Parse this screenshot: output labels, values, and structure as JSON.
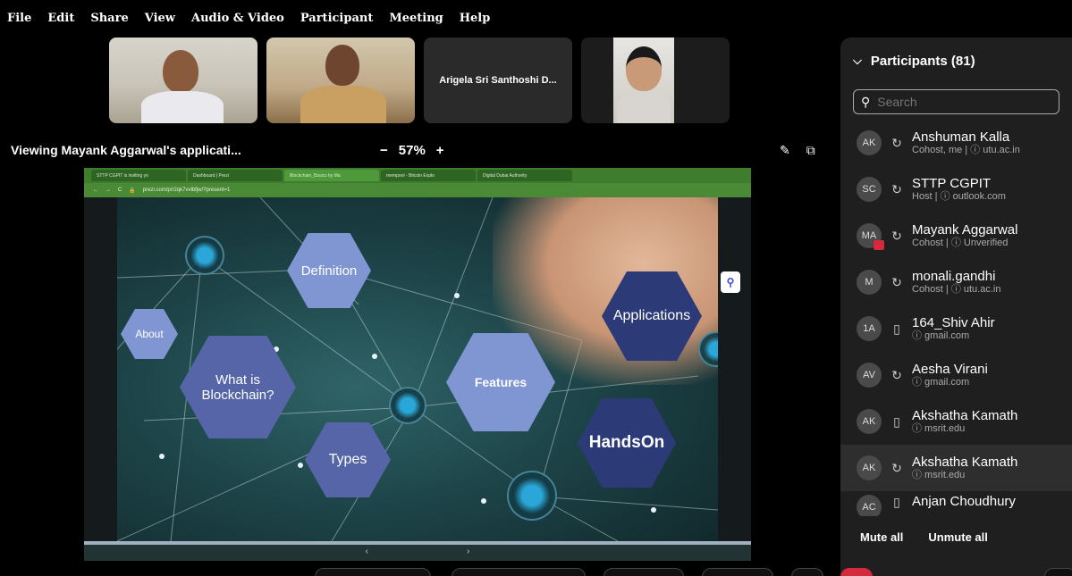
{
  "menu": [
    "File",
    "Edit",
    "Share",
    "View",
    "Audio & Video",
    "Participant",
    "Meeting",
    "Help"
  ],
  "tiles": {
    "third_name": "Arigela Sri Santhoshi D..."
  },
  "viewing": {
    "label": "Viewing Mayank Aggarwal's applicati...",
    "zoom_minus": "−",
    "zoom_level": "57%",
    "zoom_plus": "+"
  },
  "browser": {
    "tabs": [
      "STTP CGPIT is inviting yo",
      "Dashboard | Prezi",
      "Blockchain_Basics by Ma",
      "mempool - Bitcoin Explo",
      "Digital Dubai Authority"
    ],
    "address": "prezi.com/p/r2qk7vvlbfjw/?present=1"
  },
  "slide": {
    "labels": {
      "definition": "Definition",
      "about": "About",
      "what_is": "What is Blockchain?",
      "types": "Types",
      "features": "Features",
      "applications": "Applications",
      "handson": "HandsOn"
    }
  },
  "panel": {
    "title": "Participants (81)",
    "search_placeholder": "Search",
    "participants": [
      {
        "initials": "AK",
        "name": "Anshuman Kalla",
        "sub": "Cohost, me | ⓘ utu.ac.in",
        "device": "headset"
      },
      {
        "initials": "SC",
        "name": "STTP CGPIT",
        "sub": "Host | ⓘ outlook.com",
        "device": "headset"
      },
      {
        "initials": "MA",
        "name": "Mayank Aggarwal",
        "sub": "Cohost | ⓘ Unverified",
        "device": "headset"
      },
      {
        "initials": "M",
        "name": "monali.gandhi",
        "sub": "Cohost | ⓘ utu.ac.in",
        "device": "headset"
      },
      {
        "initials": "1A",
        "name": "164_Shiv Ahir",
        "sub": "ⓘ gmail.com",
        "device": "mobile"
      },
      {
        "initials": "AV",
        "name": "Aesha Virani",
        "sub": "ⓘ gmail.com",
        "device": "headset"
      },
      {
        "initials": "AK",
        "name": "Akshatha Kamath",
        "sub": "ⓘ msrit.edu",
        "device": "mobile"
      },
      {
        "initials": "AK",
        "name": "Akshatha Kamath",
        "sub": "ⓘ msrit.edu",
        "device": "headset"
      },
      {
        "initials": "AC",
        "name": "Anjan Choudhury",
        "sub": "",
        "device": "mobile"
      }
    ],
    "mute_all": "Mute all",
    "unmute_all": "Unmute all"
  },
  "colors": {
    "panel_bg": "#1f1f1f",
    "hex_light": "#7f96d3",
    "hex_mid": "#5565a8",
    "hex_dark": "#2d3a78",
    "node_blue": "#2aa7d8",
    "browser_green": "#3e7d2e"
  }
}
